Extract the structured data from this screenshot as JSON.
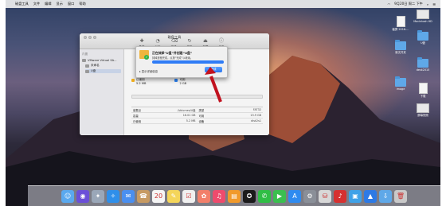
{
  "menubar": {
    "apple": "",
    "items": [
      "磁盘工具",
      "文件",
      "编辑",
      "显示",
      "窗口",
      "帮助"
    ],
    "clock": "9月20日 周二 下午"
  },
  "window": {
    "title": "磁盘工具",
    "toolbar": [
      "急救",
      "分区",
      "抹掉",
      "恢复",
      "卸载",
      "信息"
    ],
    "sidebar_header": "内置",
    "sidebar_items": [
      "VMware Virtual SA...",
      "未命名",
      "U盘"
    ],
    "usage": [
      {
        "label": "已使用",
        "value": "5.2 MB",
        "color": "#f2b01e"
      },
      {
        "label": "可用",
        "value": "2 GB",
        "color": "#2a82f3"
      }
    ],
    "info_rows": [
      {
        "k": "装载点",
        "v": "/Volumes/U盘",
        "k2": "类型",
        "v2": "FAT32"
      },
      {
        "k": "容量",
        "v": "16.01 GB",
        "k2": "可用",
        "v2": "15.9 GB"
      },
      {
        "k": "已使用",
        "v": "5.2 MB",
        "k2": "设备",
        "v2": "disk2s1"
      }
    ]
  },
  "sheet": {
    "title": "正在抹掉“U盘”并创建“U盘”",
    "message": "抹掉进程完成。点按“完成”以继续。",
    "progress": 1.0,
    "details_label": "显示详细信息",
    "done_label": "完成"
  },
  "desktop_icons": [
    {
      "label": "Macintosh HD"
    },
    {
      "label": "截屏 2016-..."
    },
    {
      "label": "U盘"
    },
    {
      "label": "新文件夹"
    },
    {
      "label": "desk2015"
    },
    {
      "label": "image"
    },
    {
      "label": "下载"
    },
    {
      "label": "屏幕快照"
    }
  ],
  "dock": [
    {
      "name": "finder-icon",
      "color": "#5aa9ef",
      "glyph": "☺"
    },
    {
      "name": "siri-icon",
      "color": "#6b4fd8",
      "glyph": "◉"
    },
    {
      "name": "launchpad-icon",
      "color": "#9aa7b8",
      "glyph": "✦"
    },
    {
      "name": "safari-icon",
      "color": "#2f8fea",
      "glyph": "✧"
    },
    {
      "name": "mail-icon",
      "color": "#4a8ff0",
      "glyph": "✉"
    },
    {
      "name": "contacts-icon",
      "color": "#c79a62",
      "glyph": "☎"
    },
    {
      "name": "calendar-icon",
      "color": "#f5f5f5",
      "glyph": "20"
    },
    {
      "name": "notes-icon",
      "color": "#f4d55a",
      "glyph": "✎"
    },
    {
      "name": "reminders-icon",
      "color": "#f0f0f0",
      "glyph": "☑"
    },
    {
      "name": "photos-icon",
      "color": "#f27f6a",
      "glyph": "✿"
    },
    {
      "name": "music-icon",
      "color": "#ee4b6d",
      "glyph": "♫"
    },
    {
      "name": "ibooks-icon",
      "color": "#f19a2b",
      "glyph": "▤"
    },
    {
      "name": "qq-icon",
      "color": "#1b1b1b",
      "glyph": "✪"
    },
    {
      "name": "wechat-icon",
      "color": "#2fbe45",
      "glyph": "✆"
    },
    {
      "name": "facetime-icon",
      "color": "#3bbf4f",
      "glyph": "▶"
    },
    {
      "name": "appstore-icon",
      "color": "#2f8bf0",
      "glyph": "A"
    },
    {
      "name": "preferences-icon",
      "color": "#8a8f98",
      "glyph": "⚙"
    },
    {
      "name": "disk-utility-icon",
      "color": "#d8d8d8",
      "glyph": "⛁"
    },
    {
      "name": "netease-music-icon",
      "color": "#d63131",
      "glyph": "♪"
    },
    {
      "name": "preview-icon",
      "color": "#3fa2e8",
      "glyph": "▣"
    },
    {
      "name": "keynote-icon",
      "color": "#2d7ae5",
      "glyph": "▲"
    },
    {
      "name": "downloads-icon",
      "color": "#5fa8e8",
      "glyph": "⇩"
    },
    {
      "name": "trash-icon",
      "color": "#c9c9c9",
      "glyph": "🗑"
    }
  ]
}
